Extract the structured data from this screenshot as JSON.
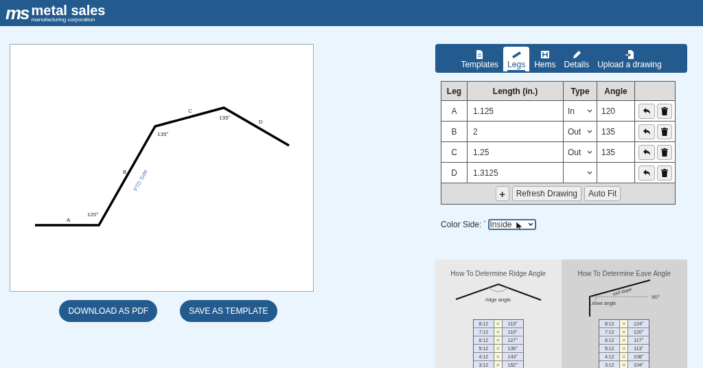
{
  "header": {
    "logo_mark": "ms",
    "brand": "metal sales",
    "tagline": "manufacturing corporation"
  },
  "drawing": {
    "leg_labels": [
      "A",
      "B",
      "C",
      "D"
    ],
    "angle_labels": [
      "120°",
      "135°",
      "135°"
    ],
    "side_label": "PTD Side"
  },
  "actions": [
    "DOWNLOAD AS PDF",
    "SAVE AS TEMPLATE"
  ],
  "tabs": [
    {
      "label": "Templates",
      "selected": false
    },
    {
      "label": "Legs",
      "selected": true
    },
    {
      "label": "Hems",
      "selected": false
    },
    {
      "label": "Details",
      "selected": false
    },
    {
      "label": "Upload a drawing",
      "selected": false
    }
  ],
  "table": {
    "columns": [
      "Leg",
      "Length (in.)",
      "Type",
      "Angle"
    ],
    "rows": [
      {
        "leg": "A",
        "length": "1.125",
        "type": "In",
        "angle": "120"
      },
      {
        "leg": "B",
        "length": "2",
        "type": "Out",
        "angle": "135"
      },
      {
        "leg": "C",
        "length": "1.25",
        "type": "Out",
        "angle": "135"
      },
      {
        "leg": "D",
        "length": "1.3125"
      }
    ],
    "footer_buttons": [
      "+",
      "Refresh Drawing",
      "Auto Fit"
    ]
  },
  "color_side": {
    "label": "Color Side:",
    "required_mark": "*",
    "value": "Inside"
  },
  "guides": [
    {
      "kind": "ridge",
      "title": "How To Determine Ridge Angle",
      "labels": [
        "ridge angle"
      ],
      "rows": [
        [
          "8:12",
          "=",
          "113°"
        ],
        [
          "7:12",
          "=",
          "119°"
        ],
        [
          "6:12",
          "=",
          "127°"
        ],
        [
          "5:12",
          "=",
          "135°"
        ],
        [
          "4:12",
          "=",
          "143°"
        ],
        [
          "3:12",
          "=",
          "152°"
        ]
      ]
    },
    {
      "kind": "eave",
      "title": "How To Determine Eave Angle",
      "labels": [
        "roof slope",
        "eave angle",
        "90°"
      ],
      "rows": [
        [
          "8:12",
          "=",
          "124°"
        ],
        [
          "7:12",
          "=",
          "120°"
        ],
        [
          "6:12",
          "=",
          "117°"
        ],
        [
          "5:12",
          "=",
          "113°"
        ],
        [
          "4:12",
          "=",
          "108°"
        ],
        [
          "3:12",
          "=",
          "104°"
        ]
      ]
    }
  ]
}
